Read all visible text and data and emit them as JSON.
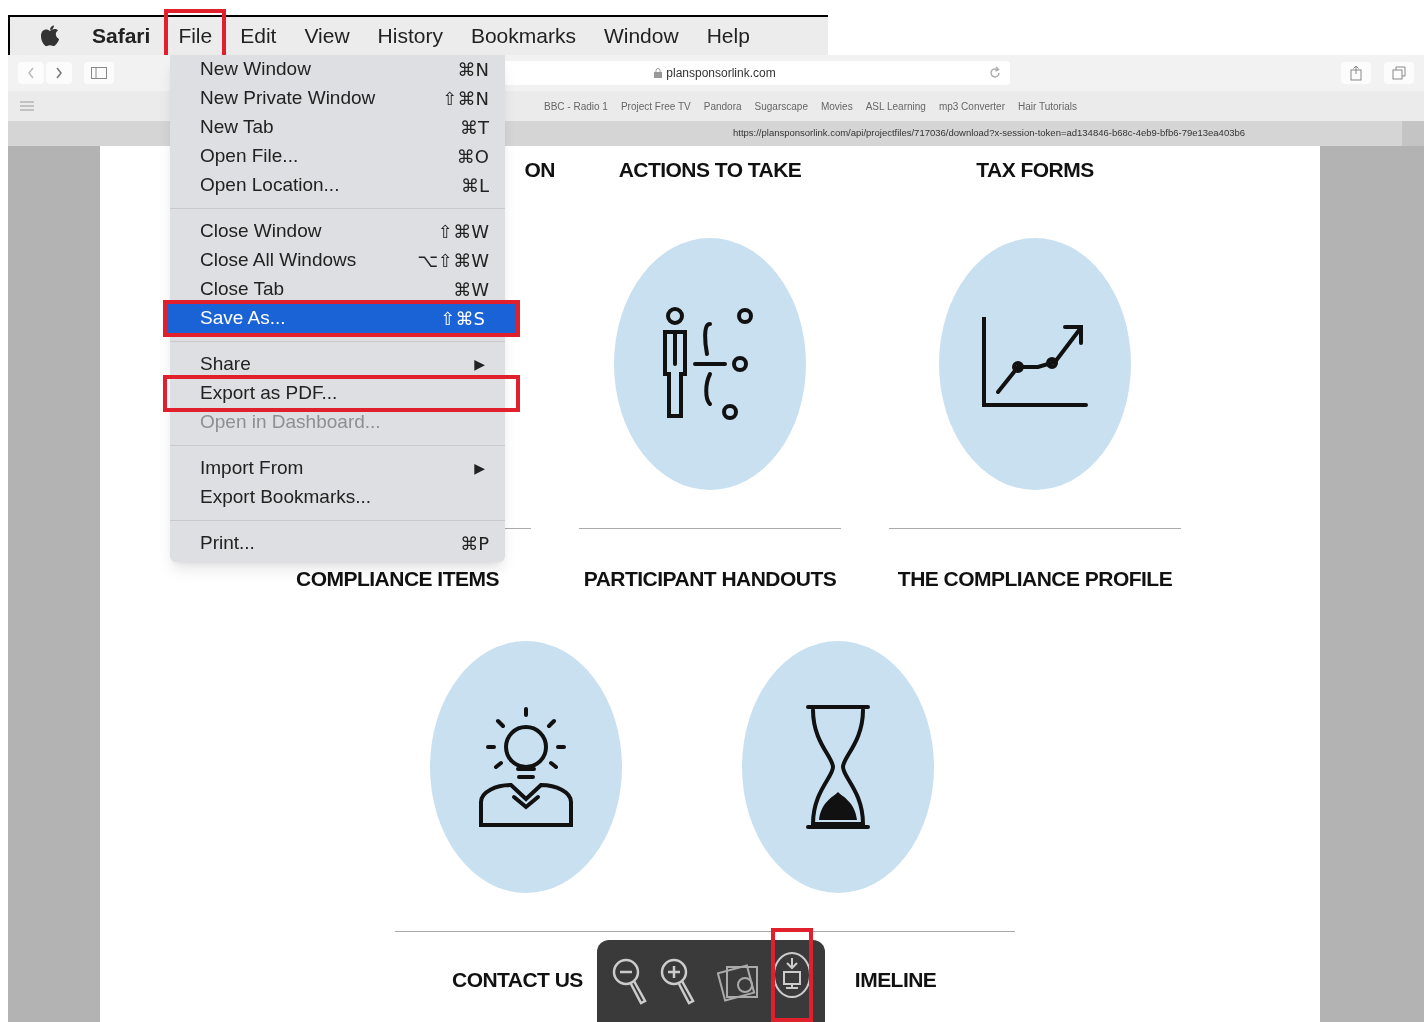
{
  "menu_bar": {
    "items": [
      {
        "label": "Safari",
        "kind": "app",
        "highlighted": false
      },
      {
        "label": "File",
        "kind": "menu",
        "highlighted": true
      },
      {
        "label": "Edit",
        "kind": "menu",
        "highlighted": false
      },
      {
        "label": "View",
        "kind": "menu",
        "highlighted": false
      },
      {
        "label": "History",
        "kind": "menu",
        "highlighted": false
      },
      {
        "label": "Bookmarks",
        "kind": "menu",
        "highlighted": false
      },
      {
        "label": "Window",
        "kind": "menu",
        "highlighted": false
      },
      {
        "label": "Help",
        "kind": "menu",
        "highlighted": false
      }
    ]
  },
  "file_menu": {
    "items": [
      {
        "kind": "item",
        "label": "New Window",
        "shortcut": "⌘N",
        "selected": false,
        "disabled": false,
        "highlighted": false
      },
      {
        "kind": "item",
        "label": "New Private Window",
        "shortcut": "⇧⌘N",
        "selected": false,
        "disabled": false,
        "highlighted": false
      },
      {
        "kind": "item",
        "label": "New Tab",
        "shortcut": "⌘T",
        "selected": false,
        "disabled": false,
        "highlighted": false
      },
      {
        "kind": "item",
        "label": "Open File...",
        "shortcut": "⌘O",
        "selected": false,
        "disabled": false,
        "highlighted": false
      },
      {
        "kind": "item",
        "label": "Open Location...",
        "shortcut": "⌘L",
        "selected": false,
        "disabled": false,
        "highlighted": false
      },
      {
        "kind": "separator"
      },
      {
        "kind": "item",
        "label": "Close Window",
        "shortcut": "⇧⌘W",
        "selected": false,
        "disabled": false,
        "highlighted": false
      },
      {
        "kind": "item",
        "label": "Close All Windows",
        "shortcut": "⌥⇧⌘W",
        "selected": false,
        "disabled": false,
        "highlighted": false
      },
      {
        "kind": "item",
        "label": "Close Tab",
        "shortcut": "⌘W",
        "selected": false,
        "disabled": false,
        "highlighted": false
      },
      {
        "kind": "item",
        "label": "Save As...",
        "shortcut": "⇧⌘S",
        "selected": true,
        "disabled": false,
        "highlighted": true
      },
      {
        "kind": "separator"
      },
      {
        "kind": "submenu",
        "label": "Share",
        "shortcut": "▶",
        "selected": false,
        "disabled": false,
        "highlighted": false
      },
      {
        "kind": "item",
        "label": "Export as PDF...",
        "selected": false,
        "disabled": false,
        "highlighted": true
      },
      {
        "kind": "item",
        "label": "Open in Dashboard...",
        "selected": false,
        "disabled": true,
        "highlighted": false
      },
      {
        "kind": "separator"
      },
      {
        "kind": "submenu",
        "label": "Import From",
        "shortcut": "▶",
        "selected": false,
        "disabled": false,
        "highlighted": false
      },
      {
        "kind": "item",
        "label": "Export Bookmarks...",
        "selected": false,
        "disabled": false,
        "highlighted": false
      },
      {
        "kind": "separator"
      },
      {
        "kind": "item",
        "label": "Print...",
        "shortcut": "⌘P",
        "selected": false,
        "disabled": false,
        "highlighted": false
      }
    ]
  },
  "browser": {
    "address": "plansponsorlink.com",
    "bookmarks": [
      "BBC - Radio 1",
      "Project Free TV",
      "Pandora",
      "Sugarscape",
      "Movies",
      "ASL Learning",
      "mp3 Converter",
      "Hair Tutorials"
    ],
    "download_url": "https://plansponsorlink.com/api/projectfiles/717036/download?x-session-token=ad134846-b68c-4eb9-bfb6-79e13ea403b6"
  },
  "page": {
    "top_headings": [
      "ON",
      "ACTIONS TO TAKE",
      "TAX FORMS"
    ],
    "top_icons": [
      {
        "kind": "strategy"
      },
      {
        "kind": "chart"
      }
    ],
    "middle_headings": [
      "COMPLIANCE ITEMS",
      "PARTICIPANT HANDOUTS",
      "THE COMPLIANCE PROFILE"
    ],
    "bottom_icons": [
      {
        "kind": "idea"
      },
      {
        "kind": "hourglass"
      }
    ],
    "bottom_headings": [
      "CONTACT US",
      "IMELINE"
    ]
  },
  "pdf_toolbar": {
    "buttons": [
      {
        "kind": "zoom_out",
        "highlighted": false
      },
      {
        "kind": "zoom_in",
        "highlighted": false
      },
      {
        "kind": "divider"
      },
      {
        "kind": "photos",
        "highlighted": false
      },
      {
        "kind": "download",
        "highlighted": true
      }
    ]
  }
}
